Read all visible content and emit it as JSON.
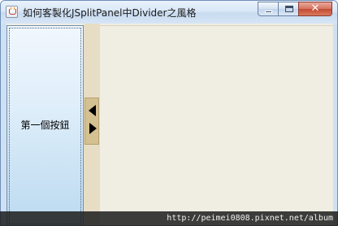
{
  "window": {
    "title": "如何客製化JSplitPanel中Divider之風格",
    "icon": "java-app-icon"
  },
  "caption_buttons": {
    "minimize_icon": "minimize-icon",
    "maximize_icon": "maximize-icon",
    "close_glyph": "✕"
  },
  "split_pane": {
    "left_button_label": "第一個按鈕",
    "divider": {
      "collapse_left_icon": "triangle-left-icon",
      "expand_right_icon": "triangle-right-icon",
      "color": "#d4c191"
    }
  },
  "watermark": {
    "text": "http://peimei0808.pixnet.net/album"
  }
}
